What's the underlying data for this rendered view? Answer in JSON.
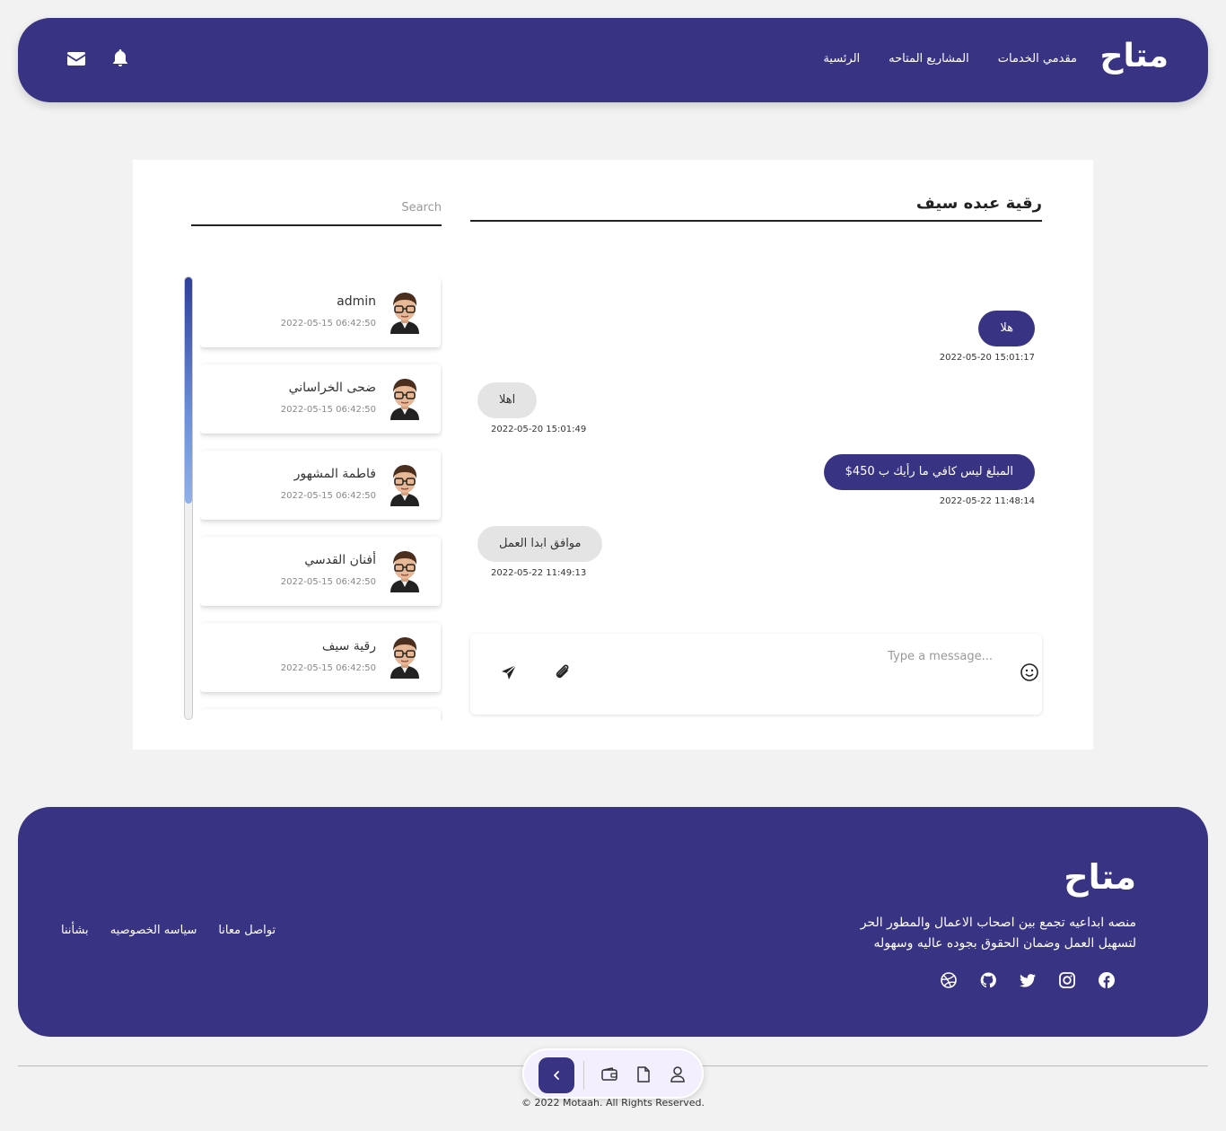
{
  "header": {
    "logo": "متاح",
    "nav": [
      "الرئسية",
      "المشاريع المتاحه",
      "مقدمي الخدمات"
    ],
    "icons": [
      "bell-icon",
      "mail-icon"
    ]
  },
  "chat": {
    "title": "رقية عبده سيف",
    "search_placeholder": "Search",
    "contacts": [
      {
        "name": "admin",
        "time": "2022-05-15 06:42:50"
      },
      {
        "name": "ضحى الخراساني",
        "time": "2022-05-15 06:42:50"
      },
      {
        "name": "فاطمة المشهور",
        "time": "2022-05-15 06:42:50"
      },
      {
        "name": "أفنان القدسي",
        "time": "2022-05-15 06:42:50"
      },
      {
        "name": "رقية سيف",
        "time": "2022-05-15 06:42:50"
      }
    ],
    "messages": [
      {
        "text": "هلا",
        "time": "2022-05-20 15:01:17",
        "direction": "out"
      },
      {
        "text": "اهلا",
        "time": "2022-05-20 15:01:49",
        "direction": "in"
      },
      {
        "text": "المبلغ ليس كافي ما رأيك ب 450$",
        "time": "2022-05-22 11:48:14",
        "direction": "out"
      },
      {
        "text": "موافق ابدا العمل",
        "time": "2022-05-22 11:49:13",
        "direction": "in"
      }
    ],
    "composer_placeholder": "Type a message..."
  },
  "footer": {
    "logo": "متاح",
    "description_line1": "منصه ابداعيه تجمع بين اصحاب الاعمال والمطور الحر",
    "description_line2": "لتسهيل العمل وضمان الحقوق بجوده عاليه وسهوله",
    "links": [
      "بشأننا",
      "سياسه الخصوصيه",
      "تواصل معانا"
    ],
    "social": [
      "facebook-icon",
      "instagram-icon",
      "twitter-icon",
      "github-icon",
      "dribbble-icon"
    ]
  },
  "dock": {
    "icons": [
      "back-chevron-icon",
      "wallet-icon",
      "file-icon",
      "user-icon"
    ]
  },
  "copyright": "© 2022 Motaah. All Rights Reserved.",
  "colors": {
    "primary": "#383483",
    "background": "#f2f2f2"
  }
}
